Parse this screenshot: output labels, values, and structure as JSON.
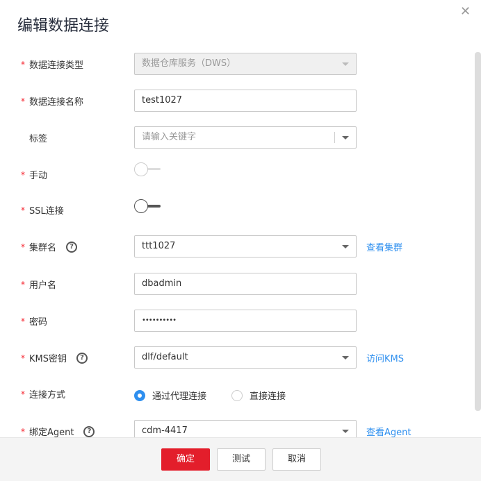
{
  "dialog": {
    "title": "编辑数据连接",
    "close_icon": "close-icon"
  },
  "fields": {
    "type": {
      "label": "数据连接类型",
      "value": "数据仓库服务（DWS）"
    },
    "name": {
      "label": "数据连接名称",
      "value": "test1027"
    },
    "tag": {
      "label": "标签",
      "placeholder": "请输入关键字"
    },
    "manual": {
      "label": "手动",
      "on": false
    },
    "ssl": {
      "label": "SSL连接",
      "on": false
    },
    "cluster": {
      "label": "集群名",
      "value": "ttt1027",
      "link": "查看集群"
    },
    "user": {
      "label": "用户名",
      "value": "dbadmin"
    },
    "password": {
      "label": "密码",
      "value": "••••••••••"
    },
    "kms": {
      "label": "KMS密钥",
      "value": "dlf/default",
      "link": "访问KMS"
    },
    "mode": {
      "label": "连接方式",
      "options": [
        "通过代理连接",
        "直接连接"
      ],
      "selected": 0
    },
    "agent": {
      "label": "绑定Agent",
      "value": "cdm-4417",
      "link": "查看Agent"
    }
  },
  "footer": {
    "ok": "确定",
    "test": "测试",
    "cancel": "取消"
  },
  "colors": {
    "primary": "#e31e2b",
    "link": "#2e8fef"
  }
}
